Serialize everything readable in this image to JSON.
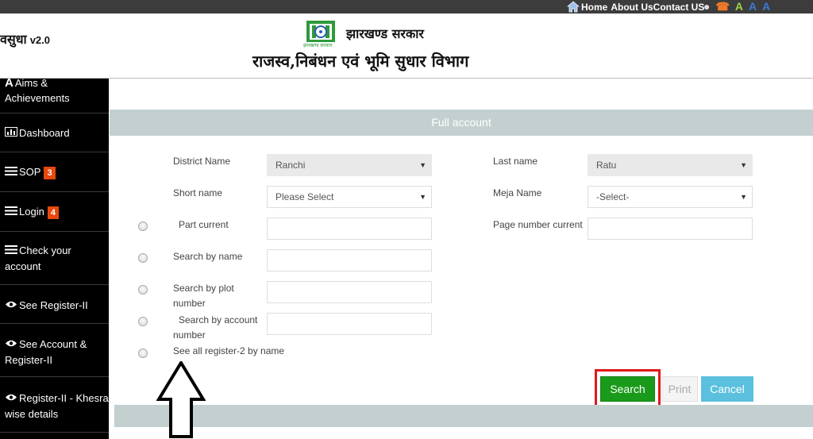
{
  "topnav": {
    "home": "Home",
    "about": "About Us",
    "contact": "Contact US"
  },
  "topicons": [
    "user-group-icon",
    "phone-icon",
    "font-increase-icon",
    "font-normal-icon",
    "font-decrease-icon"
  ],
  "header": {
    "brand": "वसुधा",
    "version": "v2.0",
    "govt": "झारखण्ड सरकार",
    "logo_caption": "झारखण्ड सरकार",
    "dept": "राजस्व,निबंधन एवं भूमि सुधार  विभाग"
  },
  "sidebar": {
    "items": [
      {
        "label": "Aims & Achievements",
        "icon": "aims-icon"
      },
      {
        "label": "Dashboard",
        "icon": "bar-chart-icon"
      },
      {
        "label": "SOP",
        "icon": "list-icon",
        "badge": "3"
      },
      {
        "label": "Login",
        "icon": "list-icon",
        "badge": "4"
      },
      {
        "label": "Check your account",
        "icon": "list-icon"
      },
      {
        "label": "See Register-II",
        "icon": "eye-icon"
      },
      {
        "label": "See Account & Register-II",
        "icon": "eye-icon"
      },
      {
        "label": "Register-II - Khesra wise details",
        "icon": "eye-icon"
      }
    ]
  },
  "form": {
    "title": "Full account",
    "district_label": "District Name",
    "district_value": "Ranchi",
    "lastname_label": "Last name",
    "lastname_value": "Ratu",
    "shortname_label": "Short name",
    "shortname_value": "Please Select",
    "meja_label": "Meja Name",
    "meja_value": "-Select-",
    "part_label": "Part current",
    "page_label": "Page number current",
    "searchname_label": "Search by name",
    "plot_label_1": "Search by plot",
    "plot_label_2": "number",
    "account_label_1": "Search by account",
    "account_label_2": "number",
    "seeall_label": "See all register-2 by name"
  },
  "buttons": {
    "search": "Search",
    "print": "Print",
    "cancel": "Cancel"
  },
  "colors": {
    "accent_green": "#1a9a1a",
    "cancel_blue": "#5bc0de",
    "highlight_red": "#e01818",
    "panel_grey": "#c4d0d0"
  }
}
